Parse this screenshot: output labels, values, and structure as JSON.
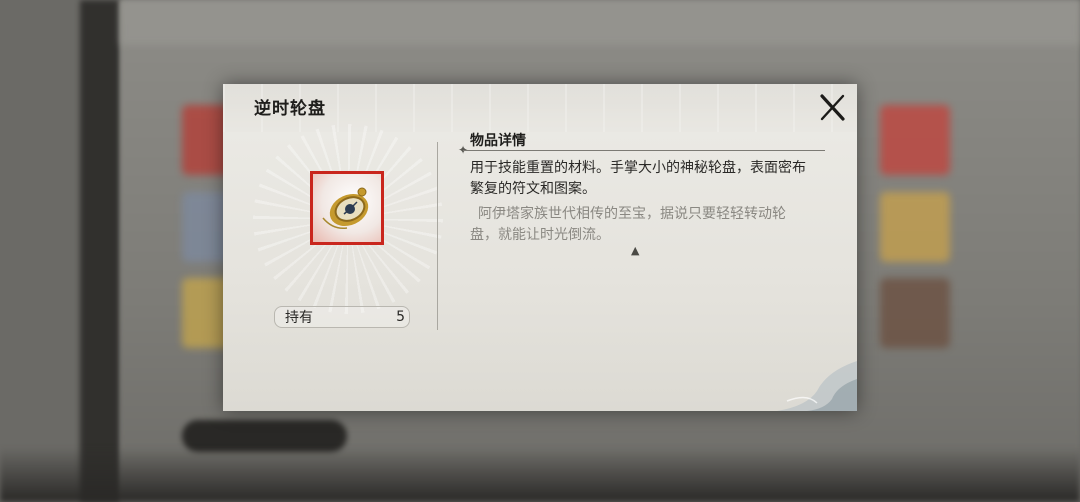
{
  "dialog": {
    "title": "逆时轮盘",
    "close_icon": "close-x-icon",
    "item": {
      "icon": "golden-pocket-watch-icon",
      "frame_color": "#c9261d"
    },
    "owned": {
      "label": "持有",
      "count": "5"
    },
    "details": {
      "heading": "物品详情",
      "description": "用于技能重置的材料。手掌大小的神秘轮盘，表面密布繁复的符文和图案。",
      "lore": "阿伊塔家族世代相传的至宝，据说只要轻轻转动轮盘，就能让时光倒流。",
      "more_indicator": "▲"
    }
  }
}
